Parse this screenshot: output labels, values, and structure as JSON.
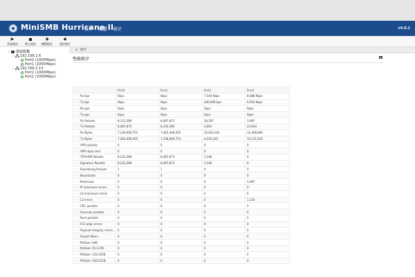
{
  "header": {
    "title": "MiniSMB Hurricane II",
    "menu": [
      "文件",
      "配置",
      "统计"
    ],
    "version": "v4.0.1"
  },
  "toolbar": {
    "buttons": [
      {
        "label": "开始测试",
        "icon": "play-icon"
      },
      {
        "label": "停止测试",
        "icon": "stop-icon"
      },
      {
        "label": "捕获报文",
        "icon": "eye-icon"
      },
      {
        "label": "清空统计",
        "icon": "eraser-icon"
      }
    ]
  },
  "tree": {
    "root": "测试机箱",
    "devices": [
      {
        "ip": "192.168.2.6",
        "ports": [
          "Port0 (1000Mbps)",
          "Port1 (1000Mbps)"
        ]
      },
      {
        "ip": "192.168.2.14",
        "ports": [
          "Port2 (1000Mbps)",
          "Port1 (1000Mbps)"
        ]
      }
    ]
  },
  "breadcrumb": "统计",
  "section_title": "性能统计",
  "table": {
    "columns": [
      "",
      "Port0",
      "Port1",
      "Port2",
      "Port3"
    ],
    "rows": [
      {
        "label": "Rx bps",
        "values": [
          "0bps",
          "0bps",
          "7.544 Kbps",
          "8.088 Kbps"
        ]
      },
      {
        "label": "Tx bps",
        "values": [
          "0bps",
          "0bps",
          "406.000 bps",
          "6.016 Kbps"
        ]
      },
      {
        "label": "Rx pps",
        "values": [
          "0pps",
          "0pps",
          "0pps",
          "0pps"
        ]
      },
      {
        "label": "Tx pps",
        "values": [
          "0pps",
          "0pps",
          "0pps",
          "0pps"
        ]
      },
      {
        "label": "Rx Packets",
        "values": [
          "8,232,289",
          "8,087,873",
          "28,597",
          "3,087"
        ]
      },
      {
        "label": "Tx Packets",
        "values": [
          "8,087,873",
          "8,232,289",
          "3,063",
          "23,644"
        ]
      },
      {
        "label": "Rx Bytes",
        "values": [
          "7,236,669,753",
          "7,462,408,505",
          "35,632,041",
          "31,408,080"
        ]
      },
      {
        "label": "Tx Bytes",
        "values": [
          "7,463,408,505",
          "7,238,669,753",
          "4,216,345",
          "32,131,932"
        ]
      },
      {
        "label": "ARP packets",
        "values": [
          "0",
          "0",
          "0",
          "0"
        ]
      },
      {
        "label": "ARP reply sent",
        "values": [
          "0",
          "0",
          "0",
          "0"
        ]
      },
      {
        "label": "TCP/UDP Packets",
        "values": [
          "8,232,289",
          "8,087,873",
          "2,246",
          "0"
        ]
      },
      {
        "label": "Signature Packets",
        "values": [
          "8,232,289",
          "8,087,873",
          "2,246",
          "0"
        ]
      },
      {
        "label": "Reordering Packets",
        "values": [
          "1",
          "1",
          "0",
          "0"
        ]
      },
      {
        "label": "Broadcasts",
        "values": [
          "0",
          "0",
          "0",
          "0"
        ]
      },
      {
        "label": "Multicasts",
        "values": [
          "0",
          "0",
          "0",
          "3,087"
        ]
      },
      {
        "label": "IP checksum errors",
        "values": [
          "0",
          "0",
          "0",
          "0"
        ]
      },
      {
        "label": "L4 checksum errors",
        "values": [
          "0",
          "0",
          "0",
          "0"
        ]
      },
      {
        "label": "L2 errors",
        "values": [
          "0",
          "0",
          "0",
          "1,124"
        ]
      },
      {
        "label": "CRC packets",
        "values": [
          "0",
          "0",
          "0",
          "0"
        ]
      },
      {
        "label": "Oversize packets",
        "values": [
          "0",
          "0",
          "0",
          "0"
        ]
      },
      {
        "label": "Runt packets",
        "values": [
          "0",
          "0",
          "0",
          "0"
        ]
      },
      {
        "label": "FCS align errors",
        "values": [
          "0",
          "0",
          "0",
          "0"
        ]
      },
      {
        "label": "Payload integrity check er...",
        "values": [
          "0",
          "0",
          "0",
          "0"
        ]
      },
      {
        "label": "Packet filters",
        "values": [
          "0",
          "0",
          "0",
          "0"
        ]
      },
      {
        "label": "PktSize: 64B",
        "values": [
          "0",
          "0",
          "0",
          "0"
        ]
      },
      {
        "label": "PktSize: 65-127B",
        "values": [
          "0",
          "0",
          "0",
          "0"
        ]
      },
      {
        "label": "PktSize: 128-255B",
        "values": [
          "0",
          "0",
          "0",
          "0"
        ]
      },
      {
        "label": "PktSize: 256-511B",
        "values": [
          "0",
          "0",
          "0",
          "0"
        ]
      }
    ]
  }
}
